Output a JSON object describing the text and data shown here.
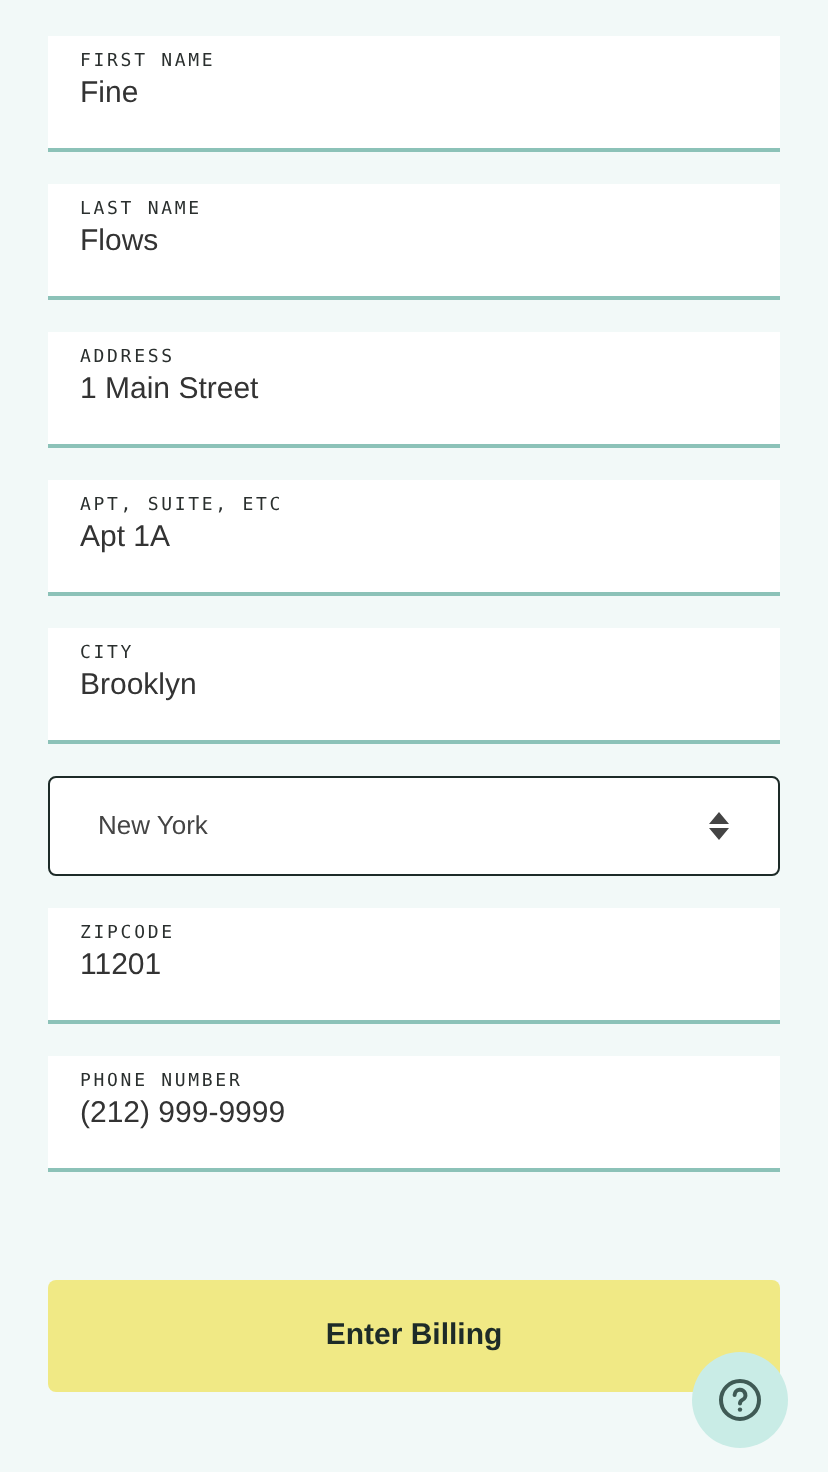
{
  "fields": [
    {
      "kind": "text",
      "label": "FIRST NAME",
      "value": "Fine"
    },
    {
      "kind": "text",
      "label": "LAST NAME",
      "value": "Flows"
    },
    {
      "kind": "text",
      "label": "ADDRESS",
      "value": "1 Main Street"
    },
    {
      "kind": "text",
      "label": "APT, SUITE, ETC",
      "value": "Apt 1A"
    },
    {
      "kind": "text",
      "label": "CITY",
      "value": "Brooklyn"
    },
    {
      "kind": "select",
      "value": "New York"
    },
    {
      "kind": "text",
      "label": "ZIPCODE",
      "value": "11201"
    },
    {
      "kind": "text",
      "label": "PHONE NUMBER",
      "value": "(212) 999-9999"
    }
  ],
  "submit_button": "Enter Billing"
}
